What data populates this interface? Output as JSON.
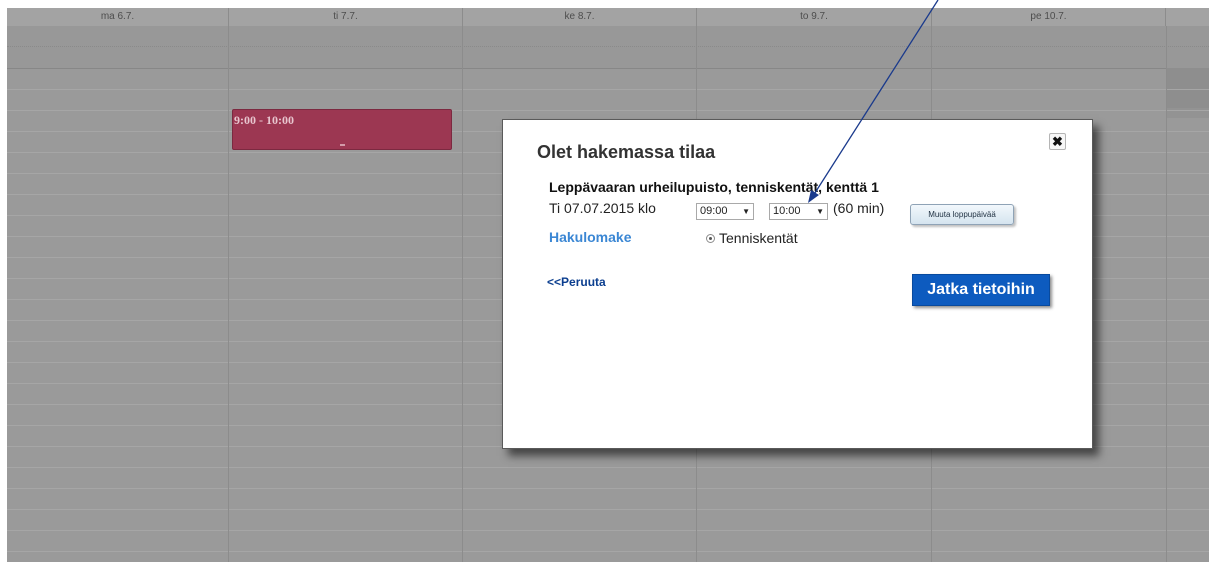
{
  "calendar": {
    "days": [
      "ma 6.7.",
      "ti 7.7.",
      "ke 8.7.",
      "to 9.7.",
      "pe 10.7."
    ],
    "event": {
      "time_label": "9:00 - 10:00"
    }
  },
  "dialog": {
    "title": "Olet hakemassa tilaa",
    "close_icon": "✖",
    "venue": "Leppävaaran urheilupuisto, tenniskentät, kenttä 1",
    "date_text": "Ti 07.07.2015 klo",
    "start_time": "09:00",
    "end_time": "10:00",
    "dash": "-",
    "duration": "(60 min)",
    "change_end_label": "Muuta loppupäivää",
    "form_link": "Hakulomake",
    "radio_label": "Tenniskentät",
    "cancel_label": "<<Peruuta",
    "continue_label": "Jatka tietoihin"
  },
  "colors": {
    "event": "#9c3752",
    "continue_button": "#0d5bbf",
    "form_link": "#3b87d4",
    "arrow": "#1a3a8c"
  }
}
